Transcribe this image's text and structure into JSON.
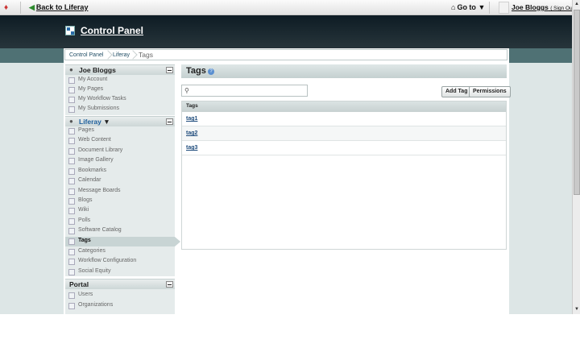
{
  "dockbar": {
    "back_label": "Back to Liferay",
    "goto_label": "Go to",
    "user_name": "Joe Bloggs",
    "sign_out": "( Sign Out )"
  },
  "header": {
    "title": "Control Panel"
  },
  "breadcrumb": [
    "Control Panel",
    "Liferay",
    "Tags"
  ],
  "sidebar": {
    "user_section": {
      "title": "Joe Bloggs",
      "items": [
        "My Account",
        "My Pages",
        "My Workflow Tasks",
        "My Submissions"
      ]
    },
    "community_section": {
      "title": "Liferay",
      "items": [
        "Pages",
        "Web Content",
        "Document Library",
        "Image Gallery",
        "Bookmarks",
        "Calendar",
        "Message Boards",
        "Blogs",
        "Wiki",
        "Polls",
        "Software Catalog",
        "Tags",
        "Categories",
        "Workflow Configuration",
        "Social Equity"
      ],
      "selected": "Tags"
    },
    "portal_section": {
      "title": "Portal",
      "items": [
        "Users",
        "Organizations"
      ]
    }
  },
  "portlet": {
    "title": "Tags",
    "search_placeholder": "",
    "buttons": {
      "add_tag": "Add Tag",
      "permissions": "Permissions"
    },
    "table_header": "Tags",
    "rows": [
      "tag1",
      "tag2",
      "tag3"
    ]
  }
}
